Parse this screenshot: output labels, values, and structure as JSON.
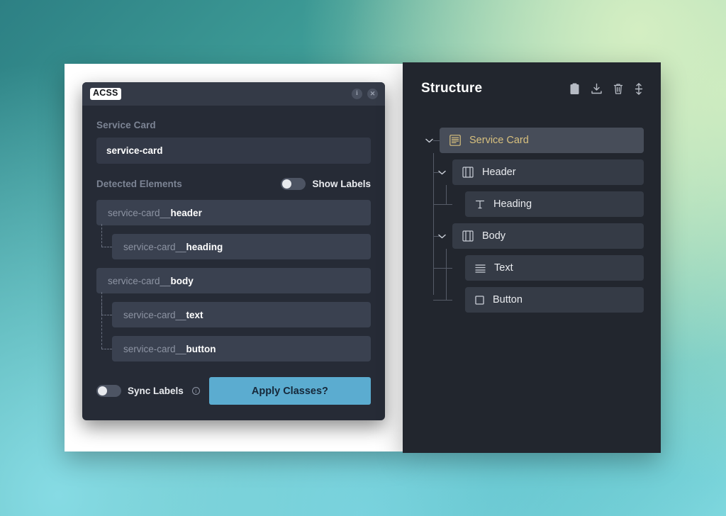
{
  "background": {
    "gradient_from": "#2d8084",
    "gradient_to": "#d4eec2",
    "accent_cyan": "#7ed7de"
  },
  "acss_modal": {
    "logo": "ACSS",
    "icons": {
      "info": "info-icon",
      "info_glyph": "i",
      "close": "close-icon",
      "close_glyph": "✕"
    },
    "field_label": "Service Card",
    "class_value": "service-card",
    "class_placeholder": "service-card",
    "detected_label": "Detected Elements",
    "show_labels_toggle": {
      "label": "Show Labels",
      "state": "off"
    },
    "detected_elements": [
      {
        "prefix": "service-card__",
        "suffix": "header",
        "indent": 0
      },
      {
        "prefix": "service-card__",
        "suffix": "heading",
        "indent": 1
      },
      {
        "prefix": "service-card__",
        "suffix": "body",
        "indent": 0
      },
      {
        "prefix": "service-card__",
        "suffix": "text",
        "indent": 1
      },
      {
        "prefix": "service-card__",
        "suffix": "button",
        "indent": 1
      }
    ],
    "footer": {
      "sync_toggle_label": "Sync Labels",
      "sync_toggle_state": "off",
      "sync_info_glyph": "i",
      "apply_button_label": "Apply Classes?",
      "apply_button_color": "#5bacd0"
    }
  },
  "structure_panel": {
    "title": "Structure",
    "tools": [
      {
        "name": "clipboard-icon"
      },
      {
        "name": "download-icon"
      },
      {
        "name": "trash-icon"
      },
      {
        "name": "move-vertical-icon"
      }
    ],
    "tree": [
      {
        "label": "Service Card",
        "icon": "layout-lines-icon",
        "level": 0,
        "expanded": true,
        "selected": true
      },
      {
        "label": "Header",
        "icon": "container-icon",
        "level": 1,
        "expanded": true,
        "selected": false
      },
      {
        "label": "Heading",
        "icon": "text-t-icon",
        "level": 2,
        "expanded": false,
        "selected": false
      },
      {
        "label": "Body",
        "icon": "container-icon",
        "level": 1,
        "expanded": true,
        "selected": false
      },
      {
        "label": "Text",
        "icon": "paragraph-icon",
        "level": 2,
        "expanded": false,
        "selected": false
      },
      {
        "label": "Button",
        "icon": "square-icon",
        "level": 2,
        "expanded": false,
        "selected": false
      }
    ],
    "selected_color": "#d8c07e"
  }
}
